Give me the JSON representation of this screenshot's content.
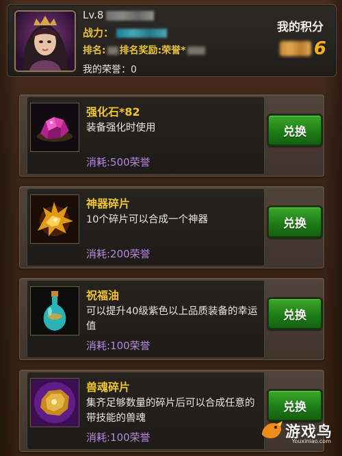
{
  "header": {
    "level_prefix": "Lv.8",
    "power_label": "战力：",
    "rank_label": "排名:",
    "rank_reward_label": "排名奖励:荣誉",
    "rank_reward_suffix": "*",
    "my_honor_label": "我的荣誉：0",
    "score_title": "我的积分",
    "score_visible_digit": "6"
  },
  "items": [
    {
      "name": "强化石*82",
      "desc": "装备强化时使用",
      "cost": "消耗:500荣誉",
      "button": "兑换",
      "icon": "pink-crystal-icon"
    },
    {
      "name": "神器碎片",
      "desc": "10个碎片可以合成一个神器",
      "cost": "消耗:200荣誉",
      "button": "兑换",
      "icon": "dragon-fragment-icon"
    },
    {
      "name": "祝福油",
      "desc": "可以提升40级紫色以上品质装备的幸运值",
      "cost": "消耗:100荣誉",
      "button": "兑换",
      "icon": "blessing-oil-bottle-icon"
    },
    {
      "name": "兽魂碎片",
      "desc": "集齐足够数量的碎片后可以合成任意的带技能的兽魂",
      "cost": "消耗:100荣誉",
      "button": "兑换",
      "icon": "beast-soul-fragment-icon"
    }
  ],
  "watermark": {
    "text": "游戏鸟",
    "sub": "Youxiniao.com"
  },
  "colors": {
    "gold": "#f0c430",
    "purple_cost": "#b88adf",
    "green_button": "#1f7d16"
  }
}
